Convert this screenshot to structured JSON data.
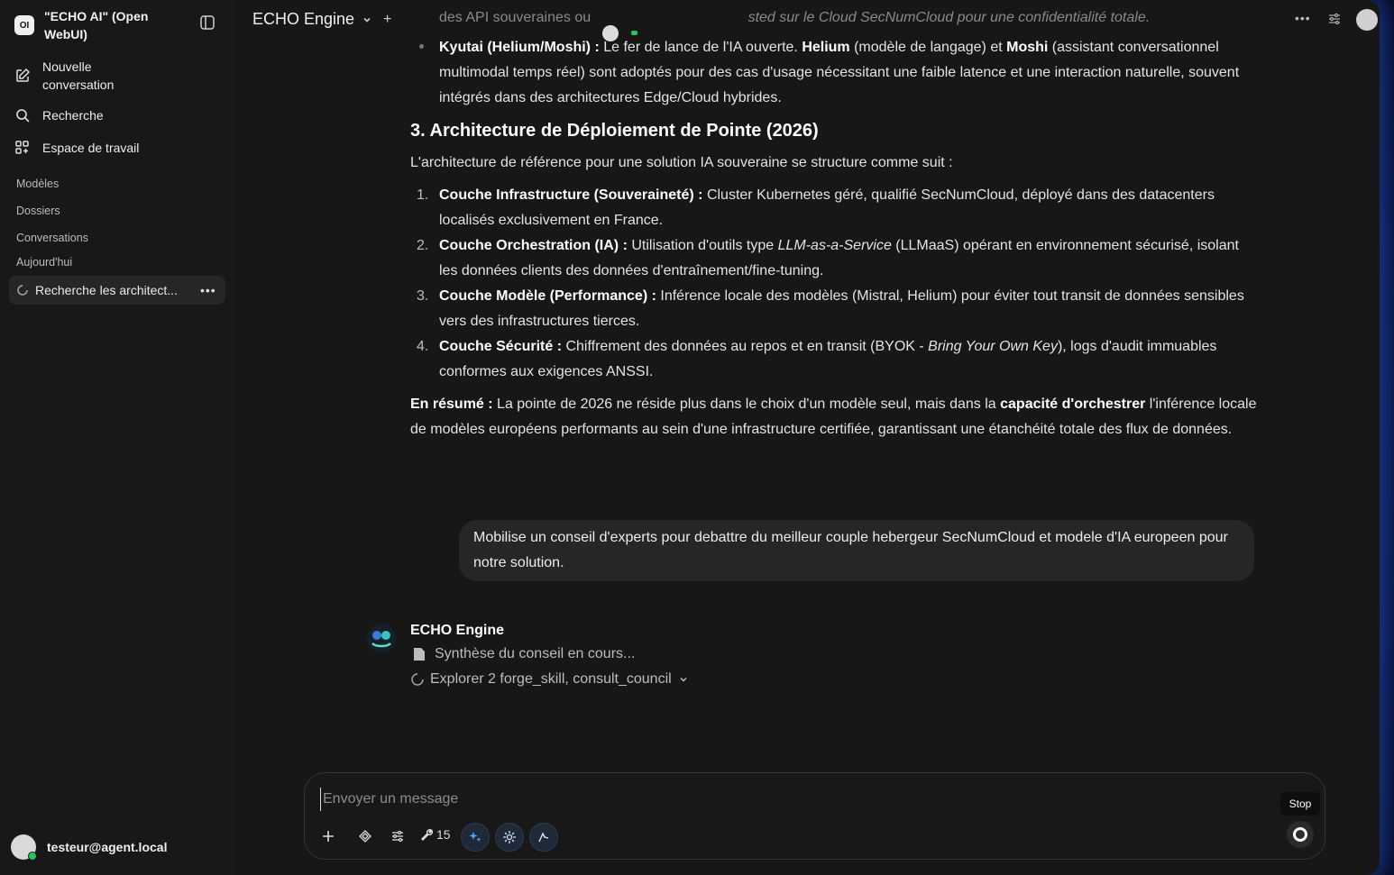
{
  "app": {
    "title": "\"ECHO AI\" (Open WebUI)",
    "logo_text": "OI"
  },
  "sidebar": {
    "nav": [
      {
        "label": "Nouvelle conversation",
        "icon": "edit-icon"
      },
      {
        "label": "Recherche",
        "icon": "search-icon"
      },
      {
        "label": "Espace de travail",
        "icon": "workspace-icon"
      }
    ],
    "sections": {
      "models": "Modèles",
      "folders": "Dossiers",
      "chats": "Conversations",
      "today": "Aujourd'hui"
    },
    "chat_items": [
      {
        "label": "Recherche les architect..."
      }
    ],
    "user_email": "testeur@agent.local"
  },
  "topbar": {
    "model_name": "ECHO Engine"
  },
  "message": {
    "faded_line_a": "des API souveraines ou ",
    "faded_line_b": "sted sur le Cloud SecNumCloud pour une confidentialité totale.",
    "bullet_kyutai_bold": "Kyutai (Helium/Moshi) :",
    "bullet_kyutai_text1": " Le fer de lance de l'IA ouverte. ",
    "bullet_kyutai_helium": "Helium",
    "bullet_kyutai_text2": " (modèle de langage) et ",
    "bullet_kyutai_moshi": "Moshi",
    "bullet_kyutai_text3": " (assistant conversationnel multimodal temps réel) sont adoptés pour des cas d'usage nécessitant une faible latence et une interaction naturelle, souvent intégrés dans des architectures Edge/Cloud hybrides.",
    "heading": "3. Architecture de Déploiement de Pointe (2026)",
    "intro": "L'architecture de référence pour une solution IA souveraine se structure comme suit :",
    "list": [
      {
        "num": "1.",
        "bold": "Couche Infrastructure (Souveraineté) :",
        "text": " Cluster Kubernetes géré, qualifié SecNumCloud, déployé dans des datacenters localisés exclusivement en France."
      },
      {
        "num": "2.",
        "bold": "Couche Orchestration (IA) :",
        "text_a": " Utilisation d'outils type ",
        "italic": "LLM-as-a-Service",
        "text_b": " (LLMaaS) opérant en environnement sécurisé, isolant les données clients des données d'entraînement/fine-tuning."
      },
      {
        "num": "3.",
        "bold": "Couche Modèle (Performance) :",
        "text": " Inférence locale des modèles (Mistral, Helium) pour éviter tout transit de données sensibles vers des infrastructures tierces."
      },
      {
        "num": "4.",
        "bold": "Couche Sécurité :",
        "text_a": " Chiffrement des données au repos et en transit (BYOK - ",
        "italic": "Bring Your Own Key",
        "text_b": "), logs d'audit immuables conformes aux exigences ANSSI."
      }
    ],
    "summary_bold": "En résumé :",
    "summary_a": " La pointe de 2026 ne réside plus dans le choix d'un modèle seul, mais dans la ",
    "summary_bold2": "capacité d'orchestrer",
    "summary_b": " l'inférence locale de modèles européens performants au sein d'une infrastructure certifiée, garantissant une étanchéité totale des flux de données."
  },
  "user_message": "Mobilise un conseil d'experts pour debattre du meilleur couple hebergeur SecNumCloud et modele d'IA europeen pour notre solution.",
  "assistant": {
    "name": "ECHO Engine",
    "status_1": "Synthèse du conseil en cours...",
    "status_2": "Explorer 2 forge_skill, consult_council"
  },
  "composer": {
    "placeholder": "Envoyer un message",
    "tools_count": "15",
    "stop_tooltip": "Stop"
  },
  "colors": {
    "accent_status": "#22c55e",
    "background": "#171717",
    "sidebar": "#181818"
  }
}
